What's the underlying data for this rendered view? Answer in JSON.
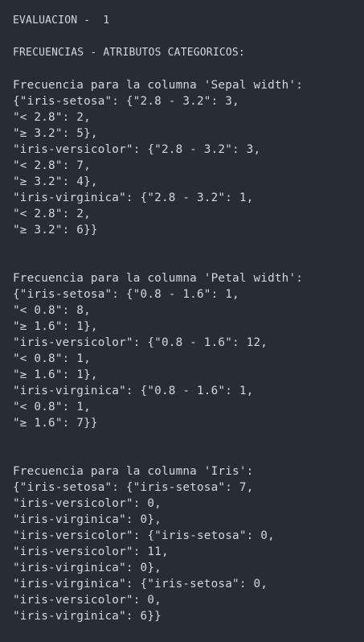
{
  "header": {
    "evaluation": "EVALUACION -  1",
    "subtitle": "FRECUENCIAS - ATRIBUTOS CATEGORICOS:"
  },
  "blocks": [
    {
      "title": "Frecuencia para la columna 'Sepal width':",
      "lines": [
        "{\"iris-setosa\": {\"2.8 - 3.2\": 3,",
        "\"< 2.8\": 2,",
        "\"≥ 3.2\": 5},",
        "\"iris-versicolor\": {\"2.8 - 3.2\": 3,",
        "\"< 2.8\": 7,",
        "\"≥ 3.2\": 4},",
        "\"iris-virginica\": {\"2.8 - 3.2\": 1,",
        "\"< 2.8\": 2,",
        "\"≥ 3.2\": 6}}"
      ]
    },
    {
      "title": "Frecuencia para la columna 'Petal width':",
      "lines": [
        "{\"iris-setosa\": {\"0.8 - 1.6\": 1,",
        "\"< 0.8\": 8,",
        "\"≥ 1.6\": 1},",
        "\"iris-versicolor\": {\"0.8 - 1.6\": 12,",
        "\"< 0.8\": 1,",
        "\"≥ 1.6\": 1},",
        "\"iris-virginica\": {\"0.8 - 1.6\": 1,",
        "\"< 0.8\": 1,",
        "\"≥ 1.6\": 7}}"
      ]
    },
    {
      "title": "Frecuencia para la columna 'Iris':",
      "lines": [
        "{\"iris-setosa\": {\"iris-setosa\": 7,",
        "\"iris-versicolor\": 0,",
        "\"iris-virginica\": 0},",
        "\"iris-versicolor\": {\"iris-setosa\": 0,",
        "\"iris-versicolor\": 11,",
        "\"iris-virginica\": 0},",
        "\"iris-virginica\": {\"iris-setosa\": 0,",
        "\"iris-versicolor\": 0,",
        "\"iris-virginica\": 6}}"
      ]
    }
  ]
}
